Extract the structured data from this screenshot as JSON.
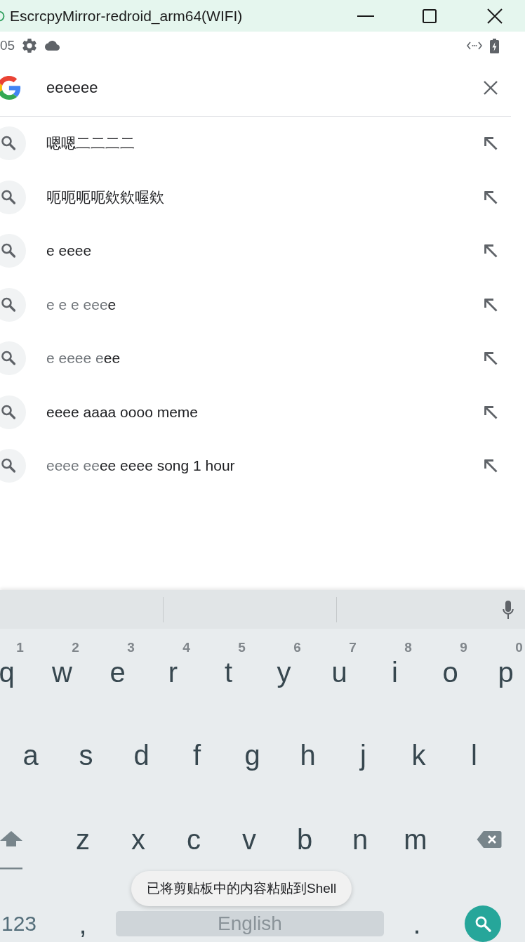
{
  "window": {
    "title": "EscrcpyMirror-redroid_arm64(WIFI)"
  },
  "status_bar": {
    "time": "05"
  },
  "search": {
    "value": "eeeeee"
  },
  "suggestions": [
    {
      "parts": [
        {
          "text": "嗯嗯二二二二",
          "dim": false
        }
      ]
    },
    {
      "parts": [
        {
          "text": "呃呃呃呃欸欸喔欸",
          "dim": false
        }
      ]
    },
    {
      "parts": [
        {
          "text": "e eeee",
          "dim": false
        }
      ]
    },
    {
      "parts": [
        {
          "text": "e e e eee",
          "dim": true
        },
        {
          "text": "e",
          "dim": false
        }
      ]
    },
    {
      "parts": [
        {
          "text": "e eeee e",
          "dim": true
        },
        {
          "text": "ee",
          "dim": false
        }
      ]
    },
    {
      "parts": [
        {
          "text": "eeee aaaa oooo meme",
          "dim": false
        }
      ]
    },
    {
      "parts": [
        {
          "text": "eeee ee",
          "dim": true
        },
        {
          "text": "ee eeee song 1 hour",
          "dim": false
        }
      ]
    }
  ],
  "keyboard": {
    "rows": [
      {
        "keys": [
          {
            "kind": "letter",
            "label": "q",
            "hint": "1"
          },
          {
            "kind": "letter",
            "label": "w",
            "hint": "2"
          },
          {
            "kind": "letter",
            "label": "e",
            "hint": "3"
          },
          {
            "kind": "letter",
            "label": "r",
            "hint": "4"
          },
          {
            "kind": "letter",
            "label": "t",
            "hint": "5"
          },
          {
            "kind": "letter",
            "label": "y",
            "hint": "6"
          },
          {
            "kind": "letter",
            "label": "u",
            "hint": "7"
          },
          {
            "kind": "letter",
            "label": "i",
            "hint": "8"
          },
          {
            "kind": "letter",
            "label": "o",
            "hint": "9"
          },
          {
            "kind": "letter",
            "label": "p",
            "hint": "0"
          }
        ]
      },
      {
        "keys": [
          {
            "kind": "letter",
            "label": "a"
          },
          {
            "kind": "letter",
            "label": "s"
          },
          {
            "kind": "letter",
            "label": "d"
          },
          {
            "kind": "letter",
            "label": "f"
          },
          {
            "kind": "letter",
            "label": "g"
          },
          {
            "kind": "letter",
            "label": "h"
          },
          {
            "kind": "letter",
            "label": "j"
          },
          {
            "kind": "letter",
            "label": "k"
          },
          {
            "kind": "letter",
            "label": "l"
          }
        ]
      },
      {
        "keys": [
          {
            "kind": "shift"
          },
          {
            "kind": "letter",
            "label": "z"
          },
          {
            "kind": "letter",
            "label": "x"
          },
          {
            "kind": "letter",
            "label": "c"
          },
          {
            "kind": "letter",
            "label": "v"
          },
          {
            "kind": "letter",
            "label": "b"
          },
          {
            "kind": "letter",
            "label": "n"
          },
          {
            "kind": "letter",
            "label": "m"
          },
          {
            "kind": "backspace"
          }
        ]
      },
      {
        "keys": [
          {
            "kind": "symbols",
            "label": "123"
          },
          {
            "kind": "punctuation",
            "label": ","
          },
          {
            "kind": "space",
            "label": "English"
          },
          {
            "kind": "punctuation",
            "label": "."
          },
          {
            "kind": "search"
          }
        ]
      }
    ]
  },
  "toast": {
    "text": "已将剪贴板中的内容粘贴到Shell"
  }
}
